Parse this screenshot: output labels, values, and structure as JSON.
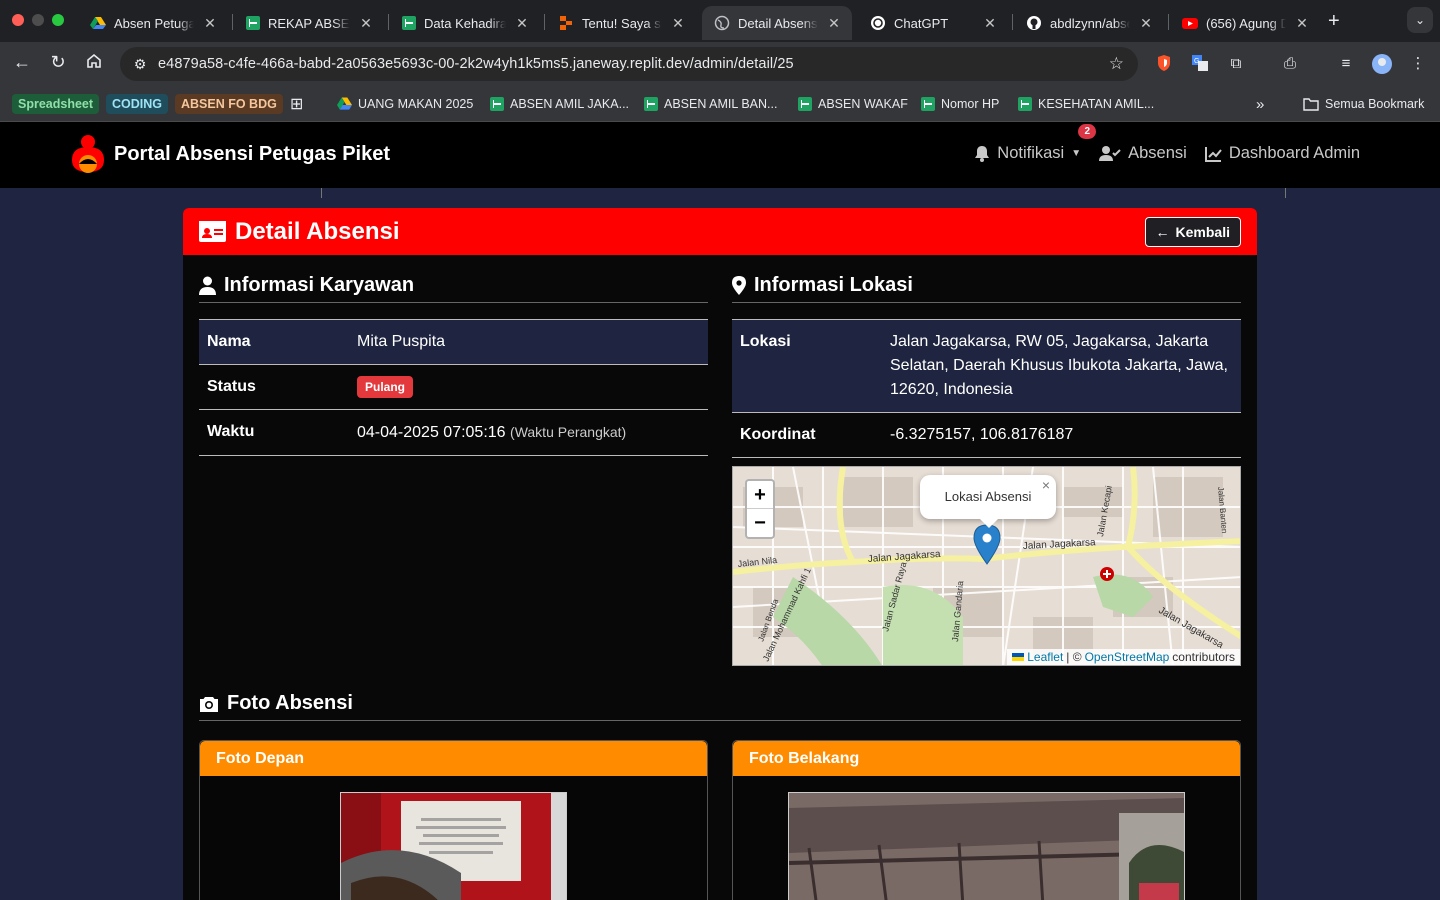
{
  "browser": {
    "tabs": [
      {
        "title": "Absen Petugas Piket",
        "icon": "google-drive-icon",
        "active": false
      },
      {
        "title": "REKAP ABSENSI",
        "icon": "google-sheets-icon",
        "active": false
      },
      {
        "title": "Data Kehadiran",
        "icon": "google-sheets-icon",
        "active": false
      },
      {
        "title": "Tentu! Saya siap",
        "icon": "replit-icon",
        "active": false
      },
      {
        "title": "Detail Absensi",
        "icon": "globe-icon",
        "active": true
      },
      {
        "title": "ChatGPT",
        "icon": "chatgpt-icon",
        "active": false
      },
      {
        "title": "abdlzynn/absen",
        "icon": "github-icon",
        "active": false
      },
      {
        "title": "(656) Agung D",
        "icon": "youtube-icon",
        "active": false
      }
    ],
    "url": "e4879a58-c4fe-466a-babd-2a0563e5693c-00-2k2w4yh1k5ms5.janeway.replit.dev/admin/detail/25",
    "bookmarks": [
      {
        "label": "Spreadsheet",
        "style": "chip",
        "color": "#1e5d3a",
        "text_color": "#8fe0a8"
      },
      {
        "label": "CODING",
        "style": "chip",
        "color": "#1f4d5c",
        "text_color": "#9ee3f5"
      },
      {
        "label": "ABSEN FO BDG",
        "style": "chip",
        "color": "#5a3a22",
        "text_color": "#f5c79e"
      },
      {
        "label": "UANG MAKAN 2025",
        "icon": "google-drive-icon"
      },
      {
        "label": "ABSEN AMIL JAKA...",
        "icon": "google-sheets-icon"
      },
      {
        "label": "ABSEN AMIL BAN...",
        "icon": "google-sheets-icon"
      },
      {
        "label": "ABSEN WAKAF",
        "icon": "google-sheets-icon"
      },
      {
        "label": "Nomor HP",
        "icon": "google-sheets-icon"
      },
      {
        "label": "KESEHATAN AMIL...",
        "icon": "google-sheets-icon"
      }
    ],
    "more_bookmarks": "»",
    "all_bookmarks": "Semua Bookmark"
  },
  "app": {
    "brand": "Portal Absensi Petugas Piket",
    "nav": {
      "notifications": "Notifikasi",
      "notification_count": "2",
      "absensi": "Absensi",
      "dashboard": "Dashboard Admin"
    }
  },
  "detail": {
    "title": "Detail Absensi",
    "back": "Kembali",
    "employee": {
      "heading": "Informasi Karyawan",
      "rows": [
        {
          "key": "Nama",
          "value": "Mita Puspita"
        },
        {
          "key": "Status",
          "value": "Pulang"
        },
        {
          "key": "Waktu",
          "value": "04-04-2025 07:05:16",
          "note": "(Waktu Perangkat)"
        }
      ]
    },
    "location": {
      "heading": "Informasi Lokasi",
      "rows": [
        {
          "key": "Lokasi",
          "value": "Jalan Jagakarsa, RW 05, Jagakarsa, Jakarta Selatan, Daerah Khusus Ibukota Jakarta, Jawa, 12620, Indonesia"
        },
        {
          "key": "Koordinat",
          "value": "-6.3275157, 106.8176187"
        }
      ],
      "map": {
        "popup": "Lokasi Absensi",
        "zoom_in": "+",
        "zoom_out": "−",
        "popup_close": "×",
        "attribution_leaflet": "Leaflet",
        "attribution_sep": "| ©",
        "attribution_osm": "OpenStreetMap",
        "attribution_suffix": "contributors",
        "street_labels": [
          "Jalan Jagakarsa",
          "Jalan Jagakarsa",
          "Jalan Nila",
          "Jalan Mohammad Kahfi 1",
          "Jalan Sadar Raya",
          "Jalan Gandaria",
          "Jalan Kecapi",
          "Jalan Banten",
          "Jalan Jagakarsa",
          "Jalan Benda"
        ]
      }
    },
    "photos": {
      "heading": "Foto Absensi",
      "front": "Foto Depan",
      "back": "Foto Belakang"
    }
  }
}
